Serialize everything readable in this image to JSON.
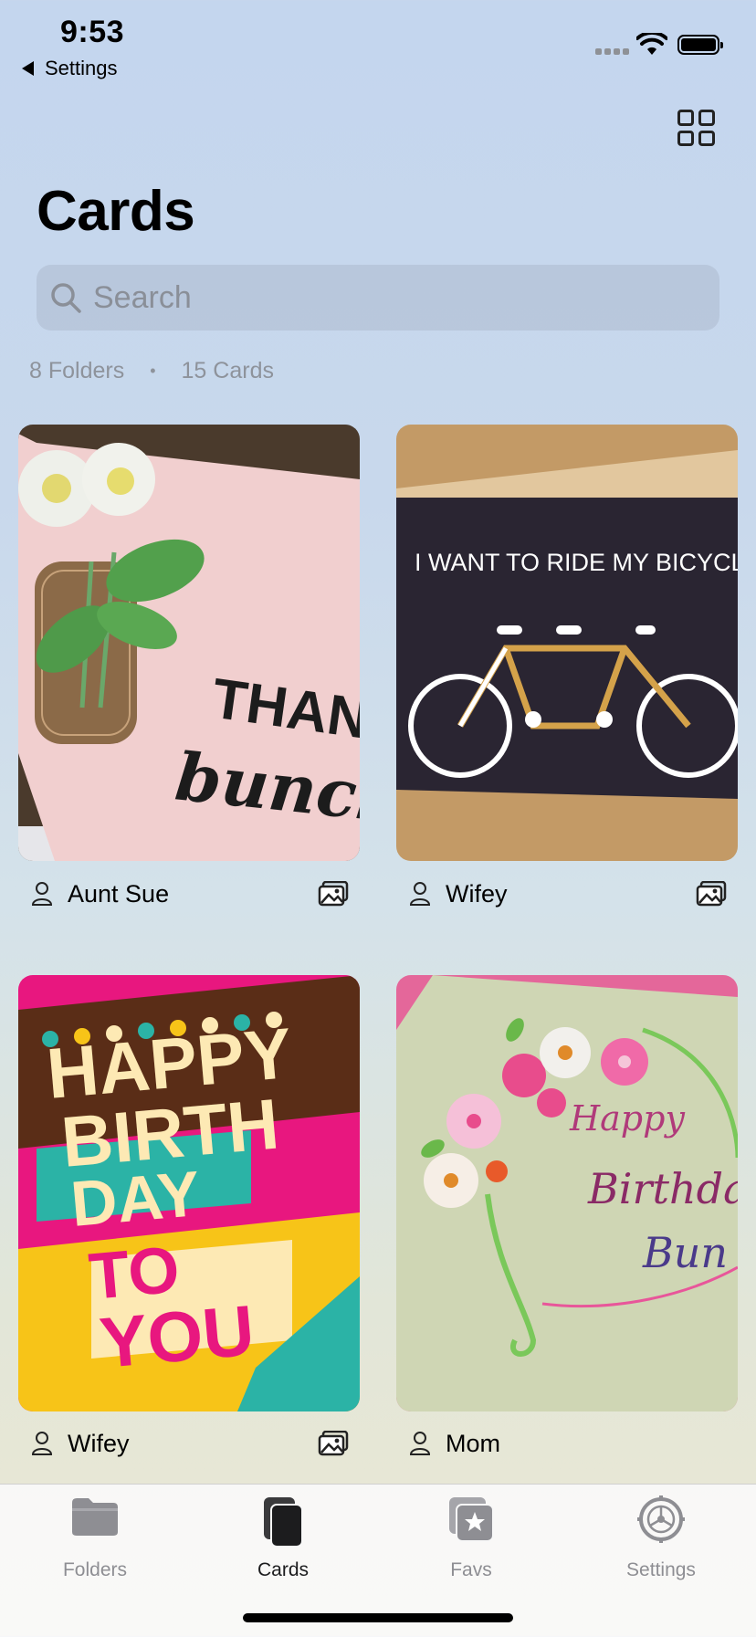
{
  "status": {
    "time": "9:53",
    "back_label": "Settings"
  },
  "header": {
    "title": "Cards"
  },
  "search": {
    "placeholder": "Search"
  },
  "summary": {
    "folders": "8 Folders",
    "cards": "15 Cards"
  },
  "cards": [
    {
      "name": "Aunt Sue",
      "has_photos": true,
      "art_text": [
        "THANK",
        "bunch"
      ]
    },
    {
      "name": "Wifey",
      "has_photos": true,
      "art_text": [
        "I WANT TO RIDE MY BICYCLE WITH YO"
      ]
    },
    {
      "name": "Wifey",
      "has_photos": true,
      "art_text": [
        "HAPPY",
        "BIRTH",
        "DAY",
        "TO",
        "YOU"
      ]
    },
    {
      "name": "Mom",
      "has_photos": false,
      "art_text": [
        "Happy",
        "Birthday",
        "Bun"
      ]
    }
  ],
  "tabs": [
    {
      "label": "Folders",
      "icon": "folder-icon"
    },
    {
      "label": "Cards",
      "icon": "cards-icon",
      "active": true
    },
    {
      "label": "Favs",
      "icon": "favorites-icon"
    },
    {
      "label": "Settings",
      "icon": "settings-icon"
    }
  ]
}
